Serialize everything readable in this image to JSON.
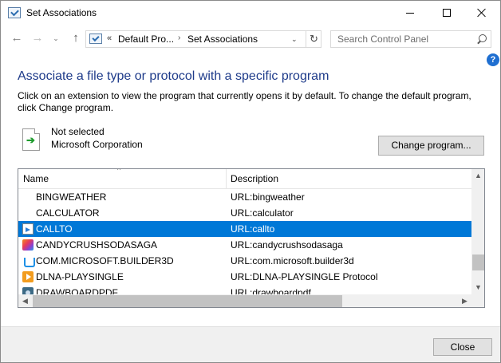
{
  "window": {
    "title": "Set Associations"
  },
  "nav": {
    "back_icon": "←",
    "forward_icon": "→",
    "recent_icon": "⌄",
    "up_icon": "↑"
  },
  "address": {
    "chevron": "«",
    "crumb1": "Default Pro...",
    "separator": "›",
    "crumb2": "Set Associations",
    "dropdown": "⌄",
    "refresh_icon": "↻"
  },
  "search": {
    "placeholder": "Search Control Panel"
  },
  "help": {
    "label": "?"
  },
  "content": {
    "heading": "Associate a file type or protocol with a specific program",
    "description": "Click on an extension to view the program that currently opens it by default. To change the default program, click Change program.",
    "program_name": "Not selected",
    "program_company": "Microsoft Corporation",
    "change_button": "Change program..."
  },
  "list": {
    "col_name": "Name",
    "col_description": "Description",
    "sort_indicator": "^",
    "rows": [
      {
        "name": "BINGWEATHER",
        "description": "URL:bingweather",
        "icon": "none",
        "selected": false
      },
      {
        "name": "CALCULATOR",
        "description": "URL:calculator",
        "icon": "none",
        "selected": false
      },
      {
        "name": "CALLTO",
        "description": "URL:callto",
        "icon": "callto-icon",
        "selected": true
      },
      {
        "name": "CANDYCRUSHSODASAGA",
        "description": "URL:candycrushsodasaga",
        "icon": "candy-crush-icon",
        "selected": false
      },
      {
        "name": "COM.MICROSOFT.BUILDER3D",
        "description": "URL:com.microsoft.builder3d",
        "icon": "builder3d-icon",
        "selected": false
      },
      {
        "name": "DLNA-PLAYSINGLE",
        "description": "URL:DLNA-PLAYSINGLE Protocol",
        "icon": "dlna-play-icon",
        "selected": false
      },
      {
        "name": "DRAWBOARDPDF",
        "description": "URL:drawboardpdf",
        "icon": "drawboard-icon",
        "selected": false
      }
    ],
    "scroll_up": "▲",
    "scroll_down": "▼",
    "scroll_left": "◀",
    "scroll_right": "▶"
  },
  "footer": {
    "close_button": "Close"
  },
  "colors": {
    "heading": "#1e3b8a",
    "selection": "#0078d7",
    "help": "#1f6fd1"
  }
}
